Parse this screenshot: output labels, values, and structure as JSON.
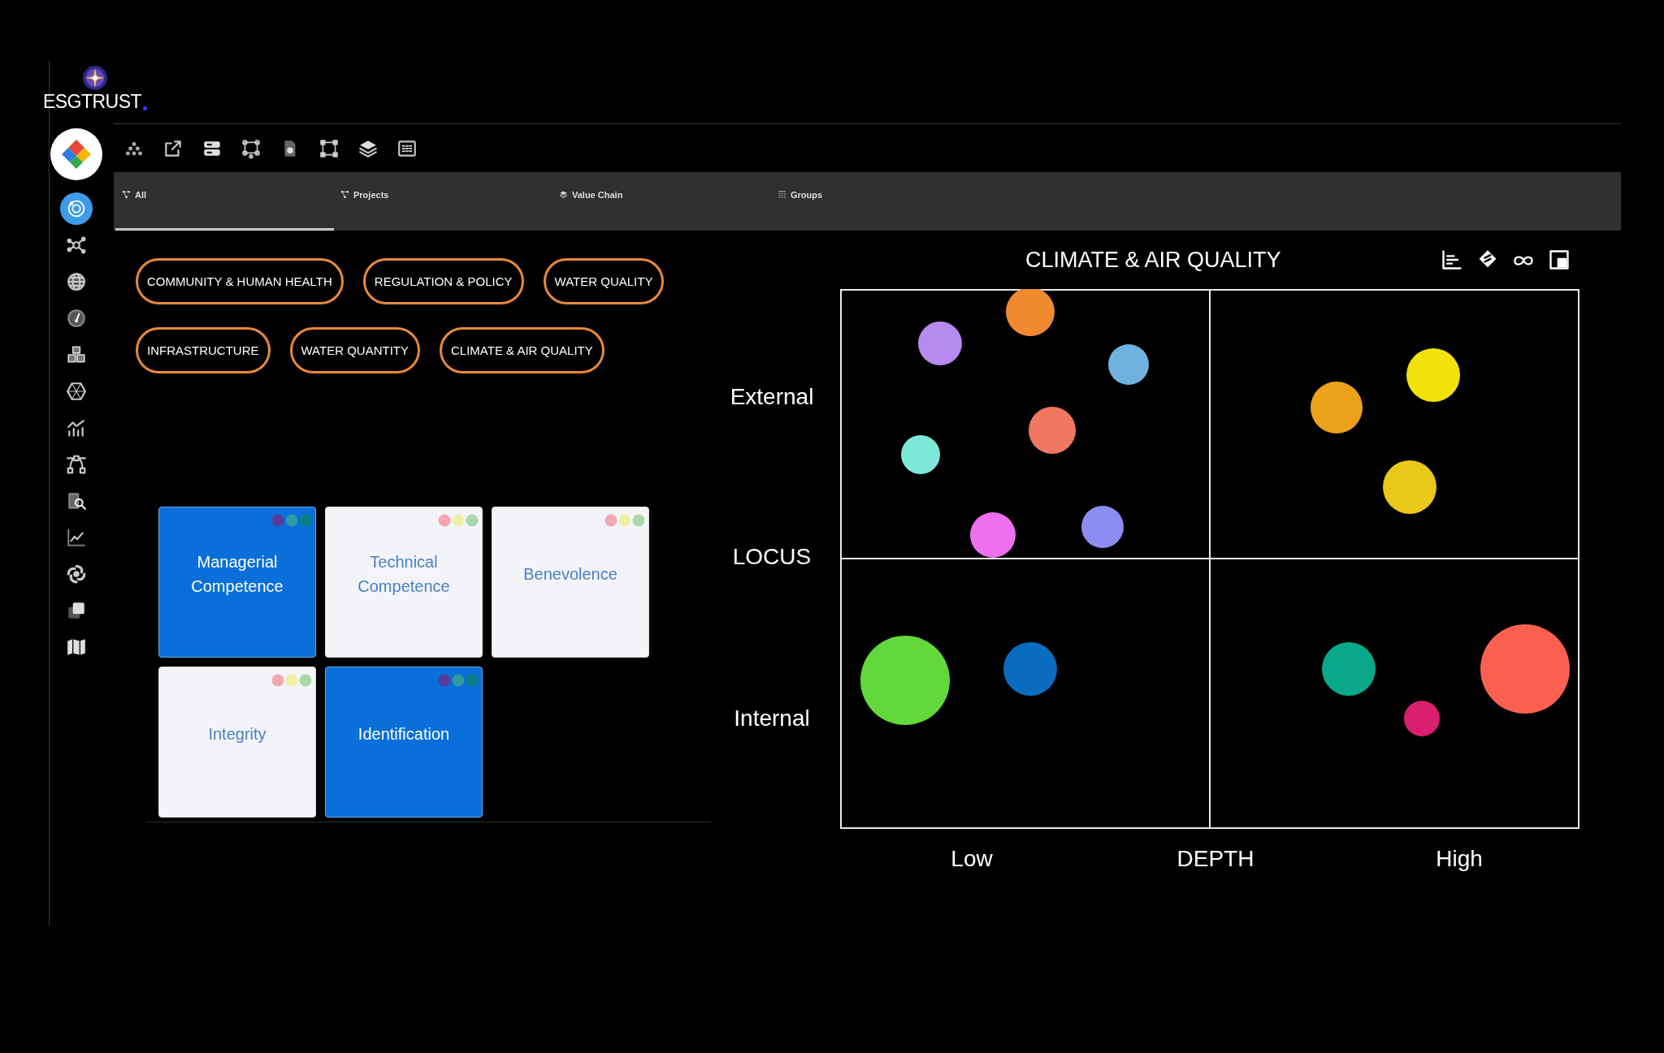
{
  "brand": {
    "name": "ESGTRUST"
  },
  "sidebar": {
    "items": [
      {
        "selected": true
      },
      {
        "selected": false
      },
      {
        "selected": false
      },
      {
        "selected": false
      },
      {
        "selected": false
      },
      {
        "selected": false
      },
      {
        "selected": false
      },
      {
        "selected": false
      },
      {
        "selected": false
      },
      {
        "selected": false
      },
      {
        "selected": false
      },
      {
        "selected": false
      },
      {
        "selected": false
      }
    ]
  },
  "tabs": [
    {
      "label": "All",
      "selected": true
    },
    {
      "label": "Projects",
      "selected": false
    },
    {
      "label": "Value Chain",
      "selected": false
    },
    {
      "label": "Groups",
      "selected": false
    }
  ],
  "topics": [
    "COMMUNITY & HUMAN HEALTH",
    "REGULATION & POLICY",
    "WATER QUALITY",
    "INFRASTRUCTURE",
    "WATER QUANTITY",
    "CLIMATE & AIR QUALITY"
  ],
  "cards": [
    {
      "label": "Managerial Competence",
      "selected": true
    },
    {
      "label": "Technical Competence",
      "selected": false
    },
    {
      "label": "Benevolence",
      "selected": false
    },
    {
      "label": "Integrity",
      "selected": false
    },
    {
      "label": "Identification",
      "selected": true
    }
  ],
  "chart": {
    "title": "CLIMATE & AIR QUALITY",
    "y_labels": [
      "External",
      "LOCUS",
      "Internal"
    ],
    "x_labels": [
      "Low",
      "DEPTH",
      "High"
    ]
  }
}
